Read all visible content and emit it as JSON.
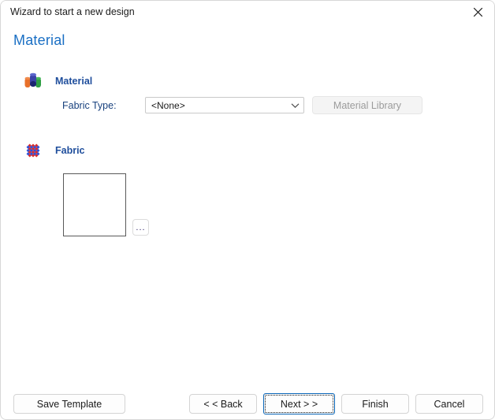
{
  "window": {
    "title": "Wizard to start a new design",
    "close_icon": "close-icon"
  },
  "page": {
    "title": "Material",
    "title_color": "#1a6fc4"
  },
  "sections": [
    {
      "id": "material",
      "label": "Material",
      "icon": "material-rolls-icon",
      "icon_colors": [
        "#e8702a",
        "#2b3a8f",
        "#2f9e44"
      ]
    },
    {
      "id": "fabric",
      "label": "Fabric",
      "icon": "fabric-weave-icon",
      "icon_colors": [
        "#d92b2b",
        "#2b4fd9"
      ]
    }
  ],
  "material_section": {
    "fabric_type": {
      "label": "Fabric Type:",
      "value": "<None>",
      "arrow_icon": "chevron-down-icon"
    },
    "material_library_button": {
      "label": "Material Library",
      "enabled": false
    }
  },
  "fabric_section": {
    "preview": {
      "empty": true
    },
    "browse_button": {
      "label": "..."
    }
  },
  "footer": {
    "save_template": "Save Template",
    "back": "< < Back",
    "next": "Next > >",
    "finish": "Finish",
    "cancel": "Cancel",
    "focused_button": "next"
  },
  "colors": {
    "accent": "#1a6fc4",
    "heading": "#1f4e9c",
    "label": "#18417e",
    "focus_border": "#0a66b8",
    "disabled_text": "#9b9b9b"
  }
}
